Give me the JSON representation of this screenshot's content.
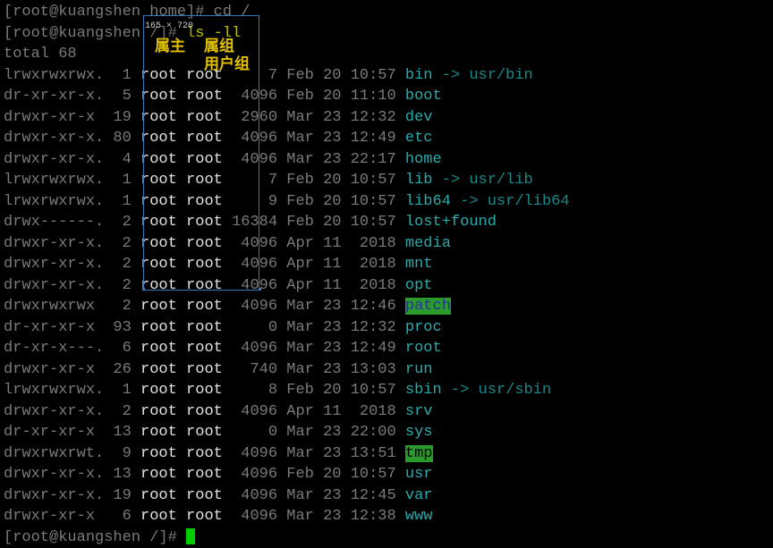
{
  "prompt1_prefix": "[root@kuangshen home]# ",
  "prompt1_cmd": "cd /",
  "prompt2_prefix": "[root@kuangshen /]# ",
  "prompt2_cmd": "ls -ll",
  "total_line": "total 68",
  "size_label": "165 × 720",
  "col_label_owner": "属主",
  "col_label_group1": "属组",
  "col_label_group2": "用户组",
  "prompt3_prefix": "[root@kuangshen /]# ",
  "rows": [
    {
      "perm": "lrwxrwxrwx.",
      "links": "  1",
      "own": "root",
      "grp": "root",
      "size": "    7",
      "date": "Feb 20 10:57",
      "name": "bin",
      "link": " -> usr/bin",
      "cls": "cyan"
    },
    {
      "perm": "dr-xr-xr-x.",
      "links": "  5",
      "own": "root",
      "grp": "root",
      "size": " 4096",
      "date": "Feb 20 11:10",
      "name": "boot",
      "link": "",
      "cls": "cyan"
    },
    {
      "perm": "drwxr-xr-x ",
      "links": " 19",
      "own": "root",
      "grp": "root",
      "size": " 2960",
      "date": "Mar 23 12:32",
      "name": "dev",
      "link": "",
      "cls": "cyan"
    },
    {
      "perm": "drwxr-xr-x.",
      "links": " 80",
      "own": "root",
      "grp": "root",
      "size": " 4096",
      "date": "Mar 23 12:49",
      "name": "etc",
      "link": "",
      "cls": "cyan"
    },
    {
      "perm": "drwxr-xr-x.",
      "links": "  4",
      "own": "root",
      "grp": "root",
      "size": " 4096",
      "date": "Mar 23 22:17",
      "name": "home",
      "link": "",
      "cls": "cyan"
    },
    {
      "perm": "lrwxrwxrwx.",
      "links": "  1",
      "own": "root",
      "grp": "root",
      "size": "    7",
      "date": "Feb 20 10:57",
      "name": "lib",
      "link": " -> usr/lib",
      "cls": "cyan"
    },
    {
      "perm": "lrwxrwxrwx.",
      "links": "  1",
      "own": "root",
      "grp": "root",
      "size": "    9",
      "date": "Feb 20 10:57",
      "name": "lib64",
      "link": " -> usr/lib64",
      "cls": "cyan"
    },
    {
      "perm": "drwx------.",
      "links": "  2",
      "own": "root",
      "grp": "root",
      "size": "16384",
      "date": "Feb 20 10:57",
      "name": "lost+found",
      "link": "",
      "cls": "cyan"
    },
    {
      "perm": "drwxr-xr-x.",
      "links": "  2",
      "own": "root",
      "grp": "root",
      "size": " 4096",
      "date": "Apr 11  2018",
      "name": "media",
      "link": "",
      "cls": "cyan"
    },
    {
      "perm": "drwxr-xr-x.",
      "links": "  2",
      "own": "root",
      "grp": "root",
      "size": " 4096",
      "date": "Apr 11  2018",
      "name": "mnt",
      "link": "",
      "cls": "cyan"
    },
    {
      "perm": "drwxr-xr-x.",
      "links": "  2",
      "own": "root",
      "grp": "root",
      "size": " 4096",
      "date": "Apr 11  2018",
      "name": "opt",
      "link": "",
      "cls": "cyan"
    },
    {
      "perm": "drwxrwxrwx ",
      "links": "  2",
      "own": "root",
      "grp": "root",
      "size": " 4096",
      "date": "Mar 23 12:46",
      "name": "patch",
      "link": "",
      "cls": "hl-patch"
    },
    {
      "perm": "dr-xr-xr-x ",
      "links": " 93",
      "own": "root",
      "grp": "root",
      "size": "    0",
      "date": "Mar 23 12:32",
      "name": "proc",
      "link": "",
      "cls": "cyan"
    },
    {
      "perm": "dr-xr-x---.",
      "links": "  6",
      "own": "root",
      "grp": "root",
      "size": " 4096",
      "date": "Mar 23 12:49",
      "name": "root",
      "link": "",
      "cls": "cyan"
    },
    {
      "perm": "drwxr-xr-x ",
      "links": " 26",
      "own": "root",
      "grp": "root",
      "size": "  740",
      "date": "Mar 23 13:03",
      "name": "run",
      "link": "",
      "cls": "cyan"
    },
    {
      "perm": "lrwxrwxrwx.",
      "links": "  1",
      "own": "root",
      "grp": "root",
      "size": "    8",
      "date": "Feb 20 10:57",
      "name": "sbin",
      "link": " -> usr/sbin",
      "cls": "cyan"
    },
    {
      "perm": "drwxr-xr-x.",
      "links": "  2",
      "own": "root",
      "grp": "root",
      "size": " 4096",
      "date": "Apr 11  2018",
      "name": "srv",
      "link": "",
      "cls": "cyan"
    },
    {
      "perm": "dr-xr-xr-x ",
      "links": " 13",
      "own": "root",
      "grp": "root",
      "size": "    0",
      "date": "Mar 23 22:00",
      "name": "sys",
      "link": "",
      "cls": "cyan"
    },
    {
      "perm": "drwxrwxrwt.",
      "links": "  9",
      "own": "root",
      "grp": "root",
      "size": " 4096",
      "date": "Mar 23 13:51",
      "name": "tmp",
      "link": "",
      "cls": "hl-green"
    },
    {
      "perm": "drwxr-xr-x.",
      "links": " 13",
      "own": "root",
      "grp": "root",
      "size": " 4096",
      "date": "Feb 20 10:57",
      "name": "usr",
      "link": "",
      "cls": "cyan"
    },
    {
      "perm": "drwxr-xr-x.",
      "links": " 19",
      "own": "root",
      "grp": "root",
      "size": " 4096",
      "date": "Mar 23 12:45",
      "name": "var",
      "link": "",
      "cls": "cyan"
    },
    {
      "perm": "drwxr-xr-x ",
      "links": "  6",
      "own": "root",
      "grp": "root",
      "size": " 4096",
      "date": "Mar 23 12:38",
      "name": "www",
      "link": "",
      "cls": "cyan"
    }
  ]
}
